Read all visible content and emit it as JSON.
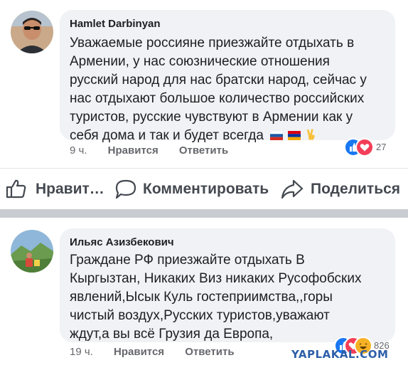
{
  "comments": [
    {
      "author": "Hamlet Darbinyan",
      "text_lines": [
        "Уважаемые россияне приезжайте отдыхать в",
        "Армении, у нас союзнические отношения",
        "русский народ для нас братски народ, сейчас у",
        "нас отдыхают большое количество российских",
        "туристов, русские чувствуют в Армении как у",
        "себя дома и так и будет всегда"
      ],
      "time": "9 ч.",
      "like_label": "Нравится",
      "reply_label": "Ответить",
      "reaction_count": "27",
      "reactions": [
        "like-icon",
        "love-icon"
      ]
    },
    {
      "author": "Ильяс Азизбекович",
      "text_lines": [
        "Граждане РФ приезжайте отдыхать В",
        "Кыргызтан, Никаких Виз никаких Русофобских",
        "явлений,Ысык Куль гостеприимства,,горы",
        "чистый воздух,Русских туристов,уважают",
        "ждут,а вы всё Грузия да Европа,"
      ],
      "time": "19 ч.",
      "like_label": "Нравится",
      "reply_label": "Ответить",
      "reaction_count": "826",
      "reactions": [
        "like-icon",
        "love-icon",
        "haha-icon"
      ]
    }
  ],
  "actions": {
    "like": "Нравит…",
    "comment": "Комментировать",
    "share": "Поделиться"
  },
  "watermark": "YAPLAKAL.COM",
  "colors": {
    "bubble": "#f0f2f5",
    "like_blue": "#1877f2",
    "love_red": "#f33e58",
    "haha_yellow": "#f7b125",
    "meta_gray": "#65676b"
  }
}
